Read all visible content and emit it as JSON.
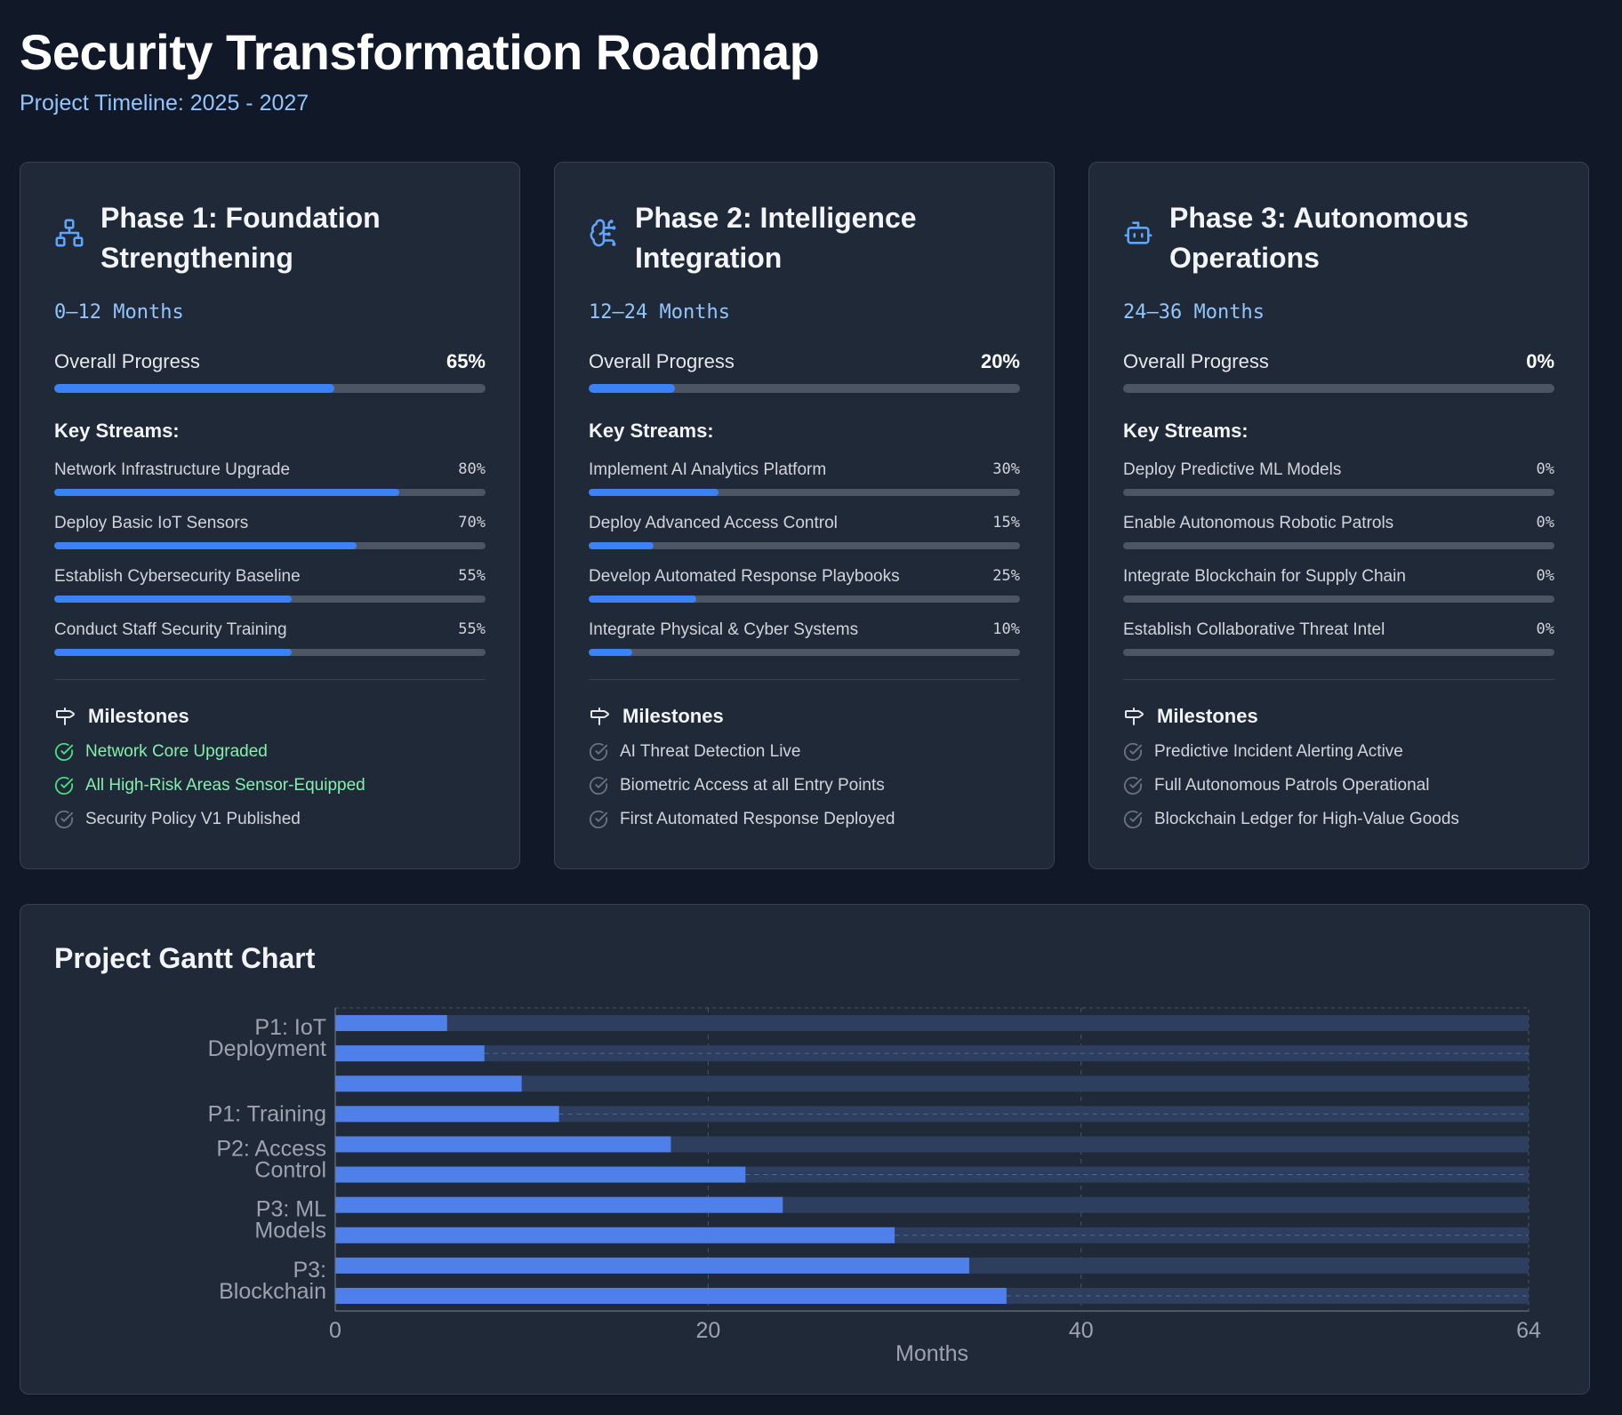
{
  "header": {
    "title": "Security Transformation Roadmap",
    "subtitle": "Project Timeline: 2025 - 2027"
  },
  "colors": {
    "background": "#111827",
    "card": "#1f2937",
    "accent": "#3b82f6",
    "accent_light": "#93c5fd",
    "success": "#86efac",
    "track": "#4b5563"
  },
  "phases": [
    {
      "icon": "network-icon",
      "title": "Phase 1: Foundation Strengthening",
      "duration": "0–12 Months",
      "progress_label": "Overall Progress",
      "progress_value": "65%",
      "progress_fraction": 0.65,
      "streams_heading": "Key Streams:",
      "streams": [
        {
          "label": "Network Infrastructure Upgrade",
          "value": "80%",
          "fraction": 0.8
        },
        {
          "label": "Deploy Basic IoT Sensors",
          "value": "70%",
          "fraction": 0.7
        },
        {
          "label": "Establish Cybersecurity Baseline",
          "value": "55%",
          "fraction": 0.55
        },
        {
          "label": "Conduct Staff Security Training",
          "value": "55%",
          "fraction": 0.55
        }
      ],
      "milestones_title": "Milestones",
      "milestones": [
        {
          "label": "Network Core Upgraded",
          "done": true
        },
        {
          "label": "All High-Risk Areas Sensor-Equipped",
          "done": true
        },
        {
          "label": "Security Policy V1 Published",
          "done": false
        }
      ]
    },
    {
      "icon": "brain-circuit-icon",
      "title": "Phase 2: Intelligence Integration",
      "duration": "12–24 Months",
      "progress_label": "Overall Progress",
      "progress_value": "20%",
      "progress_fraction": 0.2,
      "streams_heading": "Key Streams:",
      "streams": [
        {
          "label": "Implement AI Analytics Platform",
          "value": "30%",
          "fraction": 0.3
        },
        {
          "label": "Deploy Advanced Access Control",
          "value": "15%",
          "fraction": 0.15
        },
        {
          "label": "Develop Automated Response Playbooks",
          "value": "25%",
          "fraction": 0.25
        },
        {
          "label": "Integrate Physical & Cyber Systems",
          "value": "10%",
          "fraction": 0.1
        }
      ],
      "milestones_title": "Milestones",
      "milestones": [
        {
          "label": "AI Threat Detection Live",
          "done": false
        },
        {
          "label": "Biometric Access at all Entry Points",
          "done": false
        },
        {
          "label": "First Automated Response Deployed",
          "done": false
        }
      ]
    },
    {
      "icon": "robot-icon",
      "title": "Phase 3: Autonomous Operations",
      "duration": "24–36 Months",
      "progress_label": "Overall Progress",
      "progress_value": "0%",
      "progress_fraction": 0,
      "streams_heading": "Key Streams:",
      "streams": [
        {
          "label": "Deploy Predictive ML Models",
          "value": "0%",
          "fraction": 0
        },
        {
          "label": "Enable Autonomous Robotic Patrols",
          "value": "0%",
          "fraction": 0
        },
        {
          "label": "Integrate Blockchain for Supply Chain",
          "value": "0%",
          "fraction": 0
        },
        {
          "label": "Establish Collaborative Threat Intel",
          "value": "0%",
          "fraction": 0
        }
      ],
      "milestones_title": "Milestones",
      "milestones": [
        {
          "label": "Predictive Incident Alerting Active",
          "done": false
        },
        {
          "label": "Full Autonomous Patrols Operational",
          "done": false
        },
        {
          "label": "Blockchain Ledger for High-Value Goods",
          "done": false
        }
      ]
    }
  ],
  "gantt": {
    "title": "Project Gantt Chart"
  },
  "chart_data": {
    "type": "bar",
    "orientation": "horizontal",
    "title": "Project Gantt Chart",
    "xlabel": "Months",
    "ylabel": "",
    "xlim": [
      0,
      64
    ],
    "x_ticks": [
      0,
      20,
      40,
      64
    ],
    "grid": true,
    "legend": "none",
    "category_labels": [
      {
        "label": "P1: IoT Deployment",
        "lines": [
          "P1: IoT",
          "Deployment"
        ],
        "rows": [
          0,
          1
        ]
      },
      {
        "label": "P1: Training",
        "lines": [
          "P1: Training"
        ],
        "rows": [
          3
        ]
      },
      {
        "label": "P2: Access Control",
        "lines": [
          "P2: Access",
          "Control"
        ],
        "rows": [
          4,
          5
        ]
      },
      {
        "label": "P3: ML Models",
        "lines": [
          "P3: ML",
          "Models"
        ],
        "rows": [
          6,
          7
        ]
      },
      {
        "label": "P3: Blockchain",
        "lines": [
          "P3:",
          "Blockchain"
        ],
        "rows": [
          8,
          9
        ]
      }
    ],
    "bars": [
      {
        "start": 0,
        "end": 6
      },
      {
        "start": 0,
        "end": 8
      },
      {
        "start": 0,
        "end": 10
      },
      {
        "start": 0,
        "end": 12
      },
      {
        "start": 0,
        "end": 18
      },
      {
        "start": 0,
        "end": 22
      },
      {
        "start": 0,
        "end": 24
      },
      {
        "start": 0,
        "end": 30
      },
      {
        "start": 0,
        "end": 34
      },
      {
        "start": 0,
        "end": 36
      }
    ]
  }
}
